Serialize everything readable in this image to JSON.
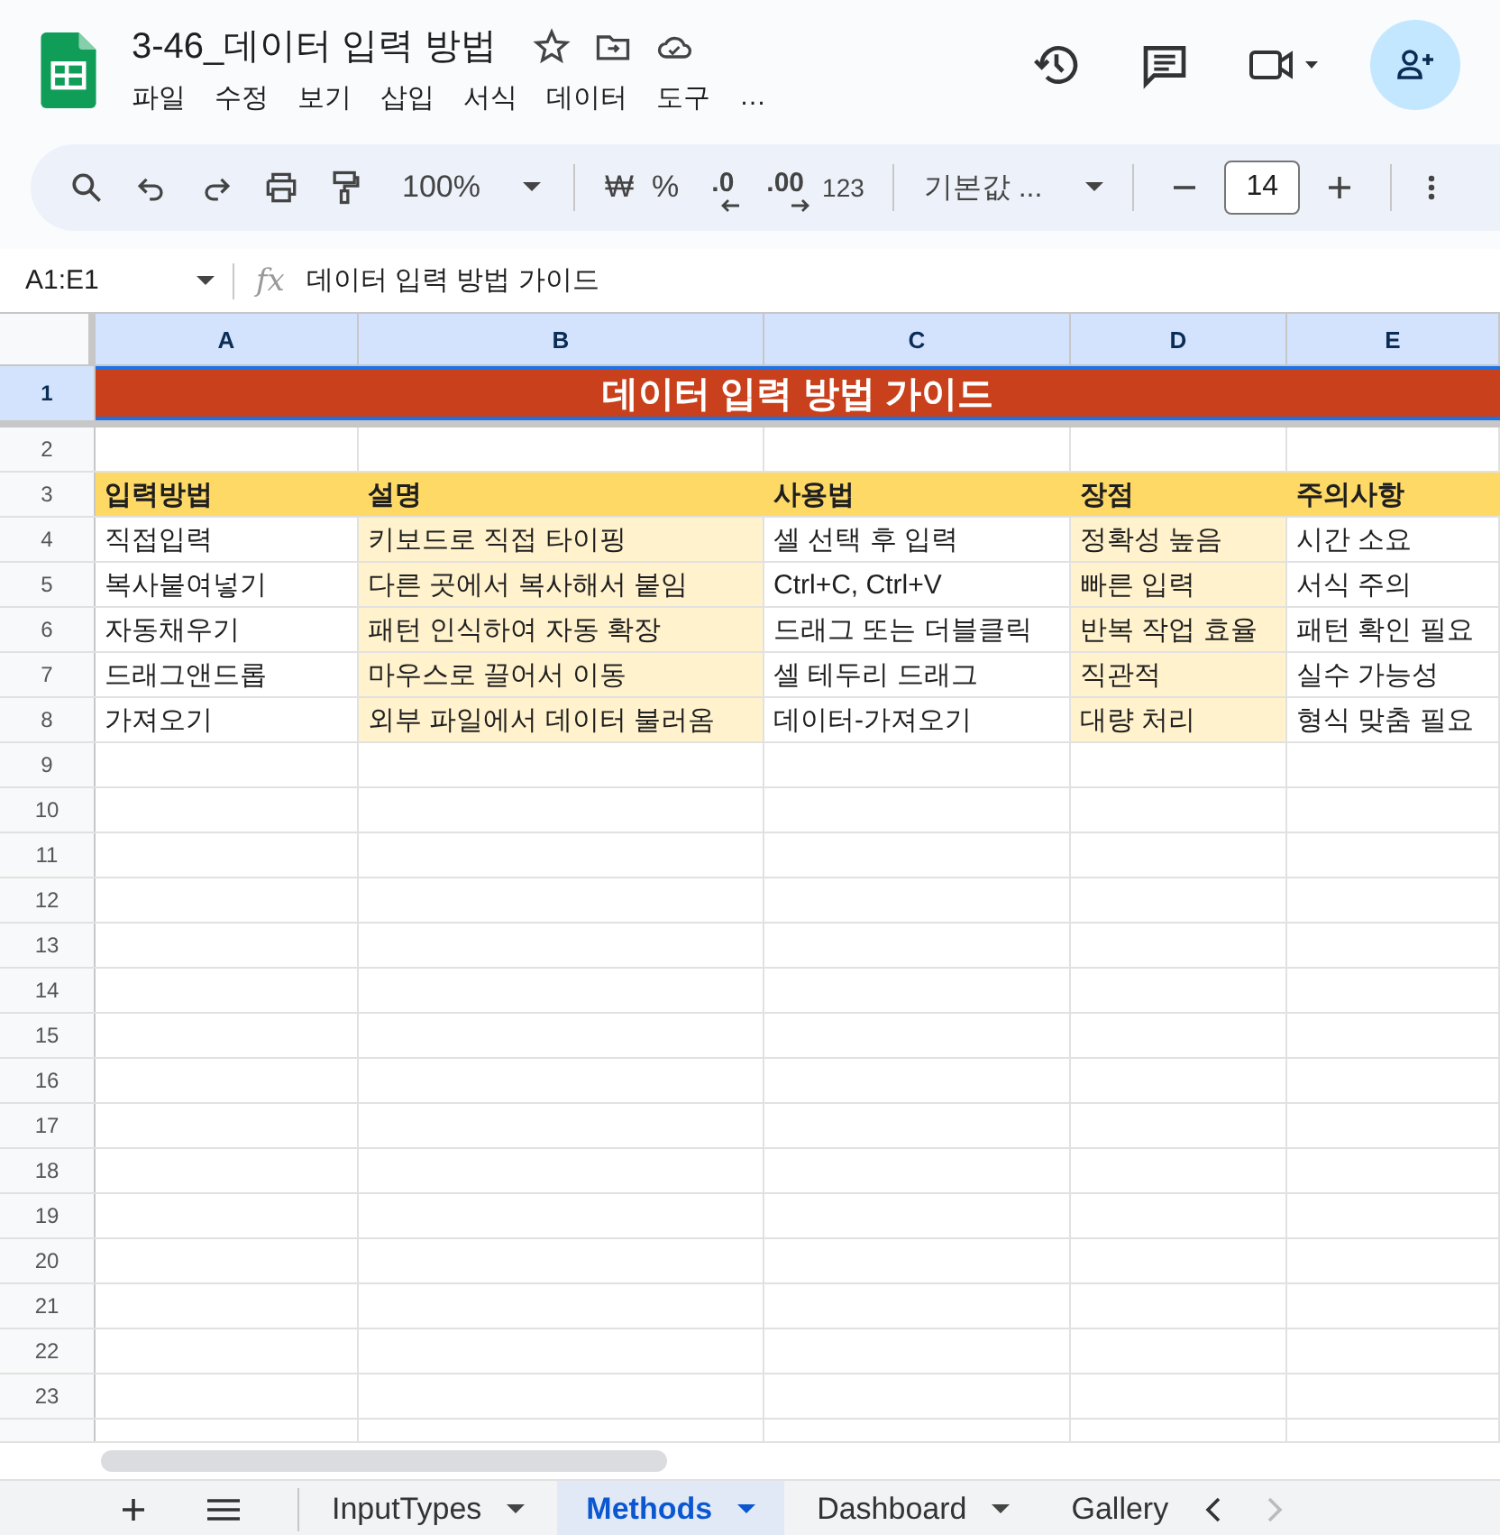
{
  "document": {
    "title": "3-46_데이터 입력 방법"
  },
  "menu": [
    "파일",
    "수정",
    "보기",
    "삽입",
    "서식",
    "데이터",
    "도구",
    "…"
  ],
  "toolbar": {
    "zoom": "100%",
    "currency": "₩",
    "percent": "%",
    "decrease_decimal": ".0",
    "increase_decimal": ".00",
    "number_format": "123",
    "font": "기본값 ...",
    "font_size": "14"
  },
  "formula_bar": {
    "cell_ref": "A1:E1",
    "fx": "fx",
    "value": "데이터 입력 방법 가이드"
  },
  "columns": [
    {
      "label": "A",
      "selected": true
    },
    {
      "label": "B",
      "selected": true
    },
    {
      "label": "C",
      "selected": true
    },
    {
      "label": "D",
      "selected": true
    },
    {
      "label": "E",
      "selected": true
    }
  ],
  "rows": [
    {
      "label": "1",
      "selected": true,
      "kind": "title",
      "title": "데이터 입력 방법 가이드"
    },
    {
      "label": "2",
      "selected": false,
      "kind": "empty"
    },
    {
      "label": "3",
      "selected": false,
      "kind": "header",
      "cells": [
        "입력방법",
        "설명",
        "사용법",
        "장점",
        "주의사항"
      ]
    },
    {
      "label": "4",
      "selected": false,
      "kind": "data",
      "cells": [
        {
          "text": "직접입력",
          "highlight": false
        },
        {
          "text": "키보드로 직접 타이핑",
          "highlight": true
        },
        {
          "text": "셀 선택 후 입력",
          "highlight": false
        },
        {
          "text": "정확성 높음",
          "highlight": true
        },
        {
          "text": "시간 소요",
          "highlight": false
        }
      ]
    },
    {
      "label": "5",
      "selected": false,
      "kind": "data",
      "cells": [
        {
          "text": "복사붙여넣기",
          "highlight": false
        },
        {
          "text": "다른 곳에서 복사해서 붙임",
          "highlight": true
        },
        {
          "text": "Ctrl+C, Ctrl+V",
          "highlight": false
        },
        {
          "text": "빠른 입력",
          "highlight": true
        },
        {
          "text": "서식 주의",
          "highlight": false
        }
      ]
    },
    {
      "label": "6",
      "selected": false,
      "kind": "data",
      "cells": [
        {
          "text": "자동채우기",
          "highlight": false
        },
        {
          "text": "패턴 인식하여 자동 확장",
          "highlight": true
        },
        {
          "text": "드래그 또는 더블클릭",
          "highlight": false
        },
        {
          "text": "반복 작업 효율",
          "highlight": true
        },
        {
          "text": "패턴 확인 필요",
          "highlight": false
        }
      ]
    },
    {
      "label": "7",
      "selected": false,
      "kind": "data",
      "cells": [
        {
          "text": "드래그앤드롭",
          "highlight": false
        },
        {
          "text": "마우스로 끌어서 이동",
          "highlight": true
        },
        {
          "text": "셀 테두리 드래그",
          "highlight": false
        },
        {
          "text": "직관적",
          "highlight": true
        },
        {
          "text": "실수 가능성",
          "highlight": false
        }
      ]
    },
    {
      "label": "8",
      "selected": false,
      "kind": "data",
      "cells": [
        {
          "text": "가져오기",
          "highlight": false
        },
        {
          "text": "외부 파일에서 데이터 불러옴",
          "highlight": true
        },
        {
          "text": "데이터-가져오기",
          "highlight": false
        },
        {
          "text": "대량 처리",
          "highlight": true
        },
        {
          "text": "형식 맞춤 필요",
          "highlight": false
        }
      ]
    },
    {
      "label": "9",
      "selected": false,
      "kind": "empty"
    },
    {
      "label": "10",
      "selected": false,
      "kind": "empty"
    },
    {
      "label": "11",
      "selected": false,
      "kind": "empty"
    },
    {
      "label": "12",
      "selected": false,
      "kind": "empty"
    },
    {
      "label": "13",
      "selected": false,
      "kind": "empty"
    },
    {
      "label": "14",
      "selected": false,
      "kind": "empty"
    },
    {
      "label": "15",
      "selected": false,
      "kind": "empty"
    },
    {
      "label": "16",
      "selected": false,
      "kind": "empty"
    },
    {
      "label": "17",
      "selected": false,
      "kind": "empty"
    },
    {
      "label": "18",
      "selected": false,
      "kind": "empty"
    },
    {
      "label": "19",
      "selected": false,
      "kind": "empty"
    },
    {
      "label": "20",
      "selected": false,
      "kind": "empty"
    },
    {
      "label": "21",
      "selected": false,
      "kind": "empty"
    },
    {
      "label": "22",
      "selected": false,
      "kind": "empty"
    },
    {
      "label": "23",
      "selected": false,
      "kind": "empty"
    }
  ],
  "sheet_tabs": [
    {
      "label": "InputTypes",
      "selected": false
    },
    {
      "label": "Methods",
      "selected": true
    },
    {
      "label": "Dashboard",
      "selected": false
    },
    {
      "label": "Gallery",
      "selected": false
    }
  ]
}
